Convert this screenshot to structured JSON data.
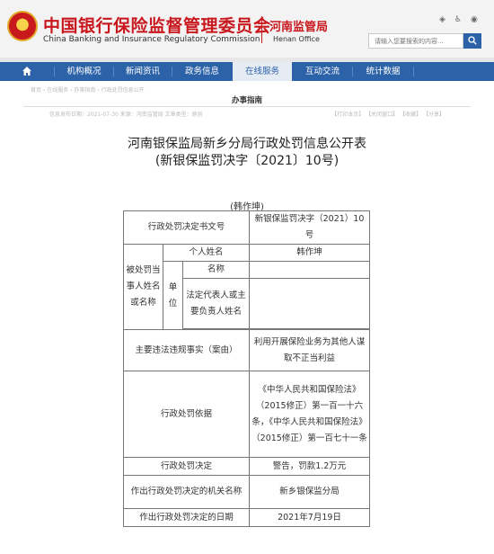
{
  "header": {
    "org_cn": "中国银行保险监督管理委员会",
    "org_en": "China Banking and Insurance Regulatory Commission",
    "office_cn": "河南监管局",
    "office_en": "Henan Office",
    "top_icons": [
      "ssdc-icon",
      "accessibility-icon",
      "weibo-icon"
    ],
    "search_placeholder": "请输入您要搜索的内容...",
    "brand_red": "#c8171d",
    "brand_blue": "#2c62a8"
  },
  "nav": {
    "items": [
      "机构概况",
      "新闻资讯",
      "政务信息",
      "在线服务",
      "互动交流",
      "统计数据"
    ],
    "active": "在线服务"
  },
  "panel": {
    "breadcrumb": "首页 › 在线服务 › 办事指南 › 行政处罚信息公开",
    "section_title": "办事指南",
    "meta_left": "信息发布日期：2021-07-30    来源：河南监管局    文章类型：原创",
    "meta_right": "【打印本页】 【关闭窗口】 【收藏】 【分享】"
  },
  "document": {
    "title_line1": "河南银保监局新乡分局行政处罚信息公开表",
    "title_line2": "(新银保监罚决字〔2021〕10号)",
    "subject": "(韩作坤)"
  },
  "table": {
    "decision_no_label": "行政处罚决定书文号",
    "decision_no_value": "新银保监罚决字（2021）10号",
    "party_group_label": "被处罚当事人姓名或名称",
    "person_label": "个人姓名",
    "person_value": "韩作坤",
    "entity_label": "单位",
    "entity_name_label": "名称",
    "entity_name_value": "",
    "legal_rep_label": "法定代表人或主要负责人姓名",
    "legal_rep_value": "",
    "violation_label": "主要违法违规事实（案由）",
    "violation_value": "利用开展保险业务为其他人谋取不正当利益",
    "basis_label": "行政处罚依据",
    "basis_value": "《中华人民共和国保险法》（2015修正）第一百一十六条，《中华人民共和国保险法》（2015修正）第一百七十一条",
    "decision_label": "行政处罚决定",
    "decision_value": "警告，罚款1.2万元",
    "authority_label": "作出行政处罚决定的机关名称",
    "authority_value": "新乡银保监分局",
    "date_label": "作出行政处罚决定的日期",
    "date_value": "2021年7月19日"
  }
}
